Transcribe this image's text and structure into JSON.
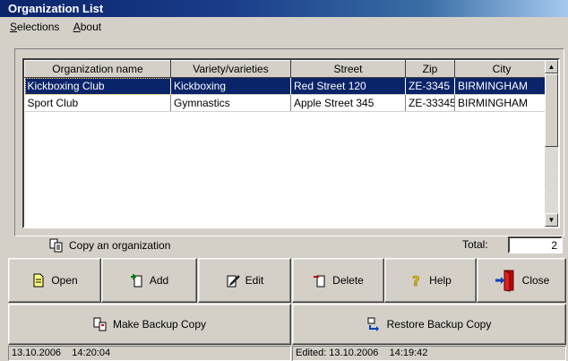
{
  "window": {
    "title": "Organization List"
  },
  "menu": [
    {
      "mnemonic": "S",
      "rest": "elections"
    },
    {
      "mnemonic": "A",
      "rest": "bout"
    }
  ],
  "grid": {
    "columns": [
      "Organization name",
      "Variety/varieties",
      "Street",
      "Zip",
      "City"
    ],
    "rows": [
      {
        "name": "Kickboxing Club",
        "variety": "Kickboxing",
        "street": "Red Street 120",
        "zip": "ZE-3345",
        "city": "BIRMINGHAM",
        "selected": true
      },
      {
        "name": "Sport Club",
        "variety": "Gymnastics",
        "street": "Apple Street 345",
        "zip": "ZE-33345",
        "city": "BIRMINGHAM",
        "selected": false
      }
    ]
  },
  "copy_label": "Copy an organization",
  "total": {
    "label": "Total:",
    "value": "2"
  },
  "buttons": {
    "open": "Open",
    "add": "Add",
    "edit": "Edit",
    "delete": "Delete",
    "help": "Help",
    "close": "Close",
    "make_backup": "Make Backup Copy",
    "restore_backup": "Restore Backup Copy"
  },
  "status": {
    "left": "13.10.2006    14:20:04",
    "right": "Edited: 13.10.2006    14:19:42"
  },
  "colors": {
    "selection": "#0a246a",
    "titlebar": "#0a246a",
    "face": "#d4d0c8"
  }
}
